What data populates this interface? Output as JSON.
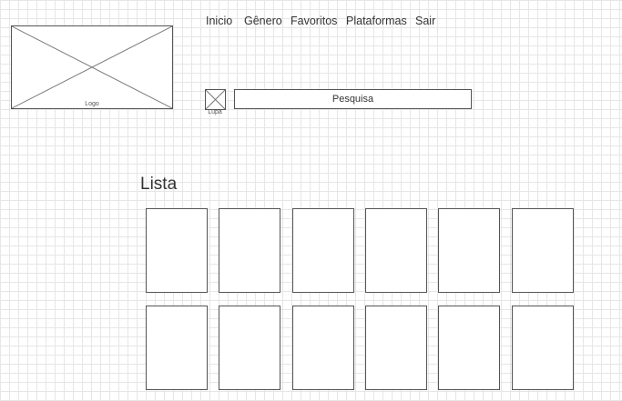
{
  "header": {
    "logo_label": "Logo",
    "nav": [
      {
        "id": "inicio",
        "label": "Inicio"
      },
      {
        "id": "genero",
        "label": "Gênero"
      },
      {
        "id": "favoritos",
        "label": "Favoritos"
      },
      {
        "id": "plataformas",
        "label": "Plataformas"
      },
      {
        "id": "sair",
        "label": "Sair"
      }
    ]
  },
  "search": {
    "icon_label": "Lupa",
    "placeholder": "Pesquisa"
  },
  "list": {
    "title": "Lista",
    "rows": 2,
    "columns": 6
  },
  "colors": {
    "border": "#555555",
    "text": "#333333",
    "grid": "#e6e6e6",
    "background": "#ffffff"
  }
}
